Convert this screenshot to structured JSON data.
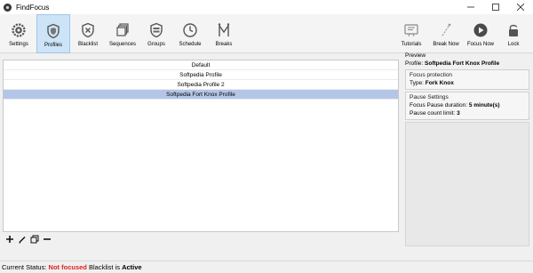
{
  "window": {
    "title": "FindFocus"
  },
  "toolbar": {
    "left": [
      {
        "label": "Settings",
        "icon": "gear-icon"
      },
      {
        "label": "Profiles",
        "icon": "shield-icon"
      },
      {
        "label": "Blacklist",
        "icon": "blocked-shield-icon"
      },
      {
        "label": "Sequences",
        "icon": "layers-icon"
      },
      {
        "label": "Groups",
        "icon": "groups-shield-icon"
      },
      {
        "label": "Schedule",
        "icon": "clock-icon"
      },
      {
        "label": "Breaks",
        "icon": "breaks-icon"
      }
    ],
    "right": [
      {
        "label": "Tutorials",
        "icon": "tutorial-icon"
      },
      {
        "label": "Break Now",
        "icon": "break-now-icon"
      },
      {
        "label": "Focus Now",
        "icon": "play-icon"
      },
      {
        "label": "Lock",
        "icon": "lock-icon"
      }
    ],
    "active": "Profiles",
    "accent": "#cde3f7"
  },
  "profiles": {
    "items": [
      "Default",
      "Softpedia Profile",
      "Softpedia Profile 2",
      "Softpedia Fort Knox Profile"
    ],
    "selected_index": 3,
    "selection_color": "#b3c6e8"
  },
  "list_tools": {
    "add": "+",
    "edit": "edit",
    "copy": "copy",
    "remove": "−"
  },
  "preview": {
    "heading": "Preview",
    "profile_label": "Profile:",
    "profile_name": "Softpedia Fort Knox Profile",
    "focus_protection": {
      "heading": "Focus protection",
      "type_label": "Type:",
      "type_value": "Fork Knox"
    },
    "pause_settings": {
      "heading": "Pause Settings",
      "duration_label": "Focus Pause duration:",
      "duration_value": "5 minute(s)",
      "limit_label": "Pause count limit:",
      "limit_value": "3"
    }
  },
  "status": {
    "label": "Current Status:",
    "focus_state": "Not focused",
    "blacklist_label": "Blacklist is",
    "blacklist_state": "Active",
    "alert_color": "#e02020"
  }
}
